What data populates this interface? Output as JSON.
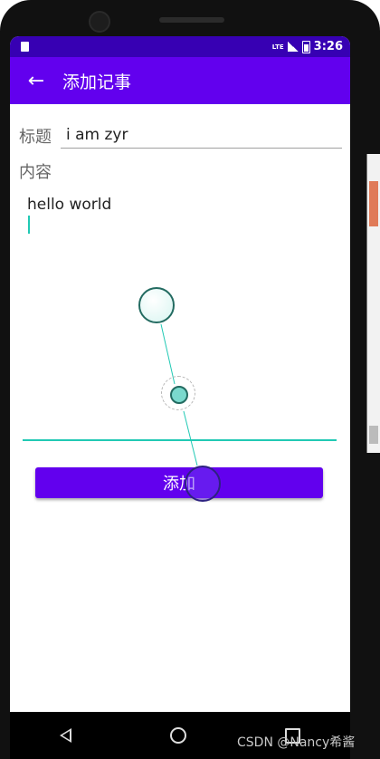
{
  "status_bar": {
    "network": "LTE",
    "time": "3:26"
  },
  "app_bar": {
    "back_icon": "arrow-back-icon",
    "title": "添加记事"
  },
  "form": {
    "title_label": "标题",
    "title_value": "i am zyr",
    "content_label": "内容",
    "content_value": "hello  world"
  },
  "add_button": {
    "label": "添加"
  },
  "nav_bar": {
    "icons": [
      "triangle-back-icon",
      "circle-home-icon",
      "square-recents-icon"
    ]
  },
  "watermark": "CSDN @Nancy希酱",
  "colors": {
    "status_bar": "#3700b3",
    "primary": "#6200ee",
    "accent": "#21c9b4"
  }
}
